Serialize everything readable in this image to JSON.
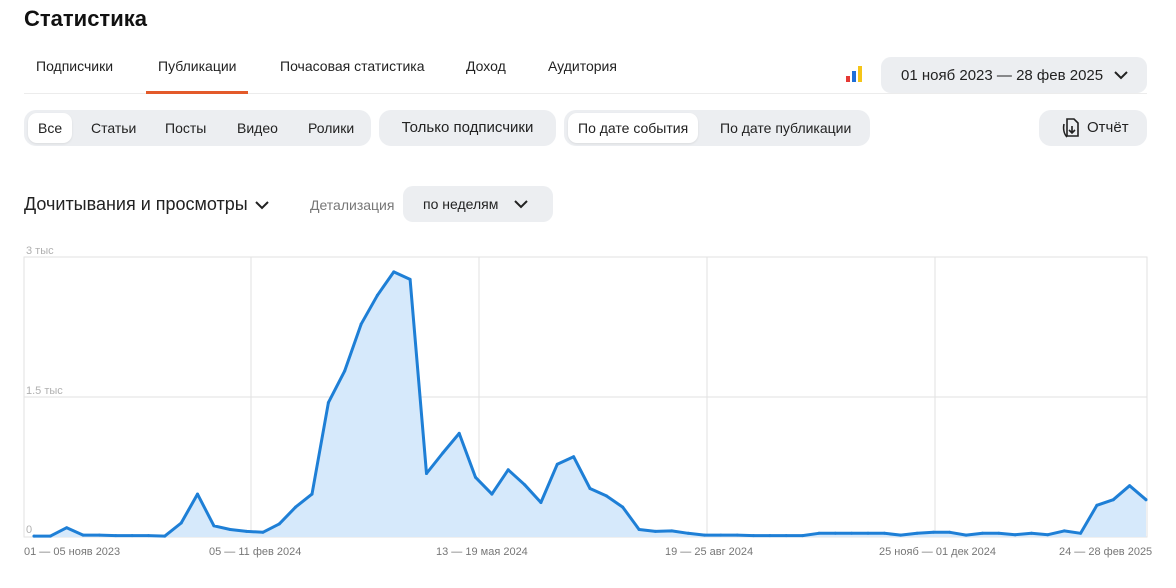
{
  "page": {
    "title": "Статистика"
  },
  "tabs": [
    {
      "label": "Подписчики",
      "active": false
    },
    {
      "label": "Публикации",
      "active": true
    },
    {
      "label": "Почасовая статистика",
      "active": false
    },
    {
      "label": "Доход",
      "active": false
    },
    {
      "label": "Аудитория",
      "active": false
    }
  ],
  "date_range": {
    "label": "01 нояб 2023 — 28 фев 2025"
  },
  "content_filter": [
    {
      "label": "Все",
      "active": true
    },
    {
      "label": "Статьи",
      "active": false
    },
    {
      "label": "Посты",
      "active": false
    },
    {
      "label": "Видео",
      "active": false
    },
    {
      "label": "Ролики",
      "active": false
    }
  ],
  "only_subscribers": {
    "label": "Только подписчики"
  },
  "date_mode": [
    {
      "label": "По дате события",
      "active": true
    },
    {
      "label": "По дате публикации",
      "active": false
    }
  ],
  "report_button": {
    "label": "Отчёт"
  },
  "metric": {
    "label": "Дочитывания и просмотры"
  },
  "detail": {
    "label": "Детализация",
    "value": "по неделям"
  },
  "colors": {
    "line": "#1e7fd6",
    "fill": "#d6e9fb",
    "active_tab_underline": "#e35a2a",
    "grid": "#e2e2e2"
  },
  "chart_data": {
    "type": "area",
    "x_tick_labels": [
      "01 — 05 нояв 2023",
      "05 — 11 фев 2024",
      "13 — 19 мая 2024",
      "19 — 25 авг 2024",
      "25 нояб — 01 дек 2024",
      "24 — 28 фев 2025"
    ],
    "y_tick_labels": [
      "3 тыс",
      "1.5 тыс",
      "0"
    ],
    "ylim": [
      0,
      3000
    ],
    "grid": true,
    "values": [
      10,
      10,
      100,
      20,
      20,
      15,
      15,
      15,
      10,
      150,
      460,
      120,
      80,
      60,
      50,
      140,
      320,
      460,
      1440,
      1780,
      2280,
      2590,
      2840,
      2760,
      680,
      900,
      1110,
      640,
      460,
      720,
      560,
      370,
      780,
      860,
      520,
      440,
      320,
      80,
      60,
      65,
      40,
      20,
      20,
      20,
      15,
      15,
      15,
      15,
      40,
      40,
      40,
      40,
      40,
      20,
      40,
      50,
      50,
      20,
      40,
      40,
      25,
      40,
      25,
      65,
      40,
      340,
      400,
      550,
      400
    ]
  }
}
